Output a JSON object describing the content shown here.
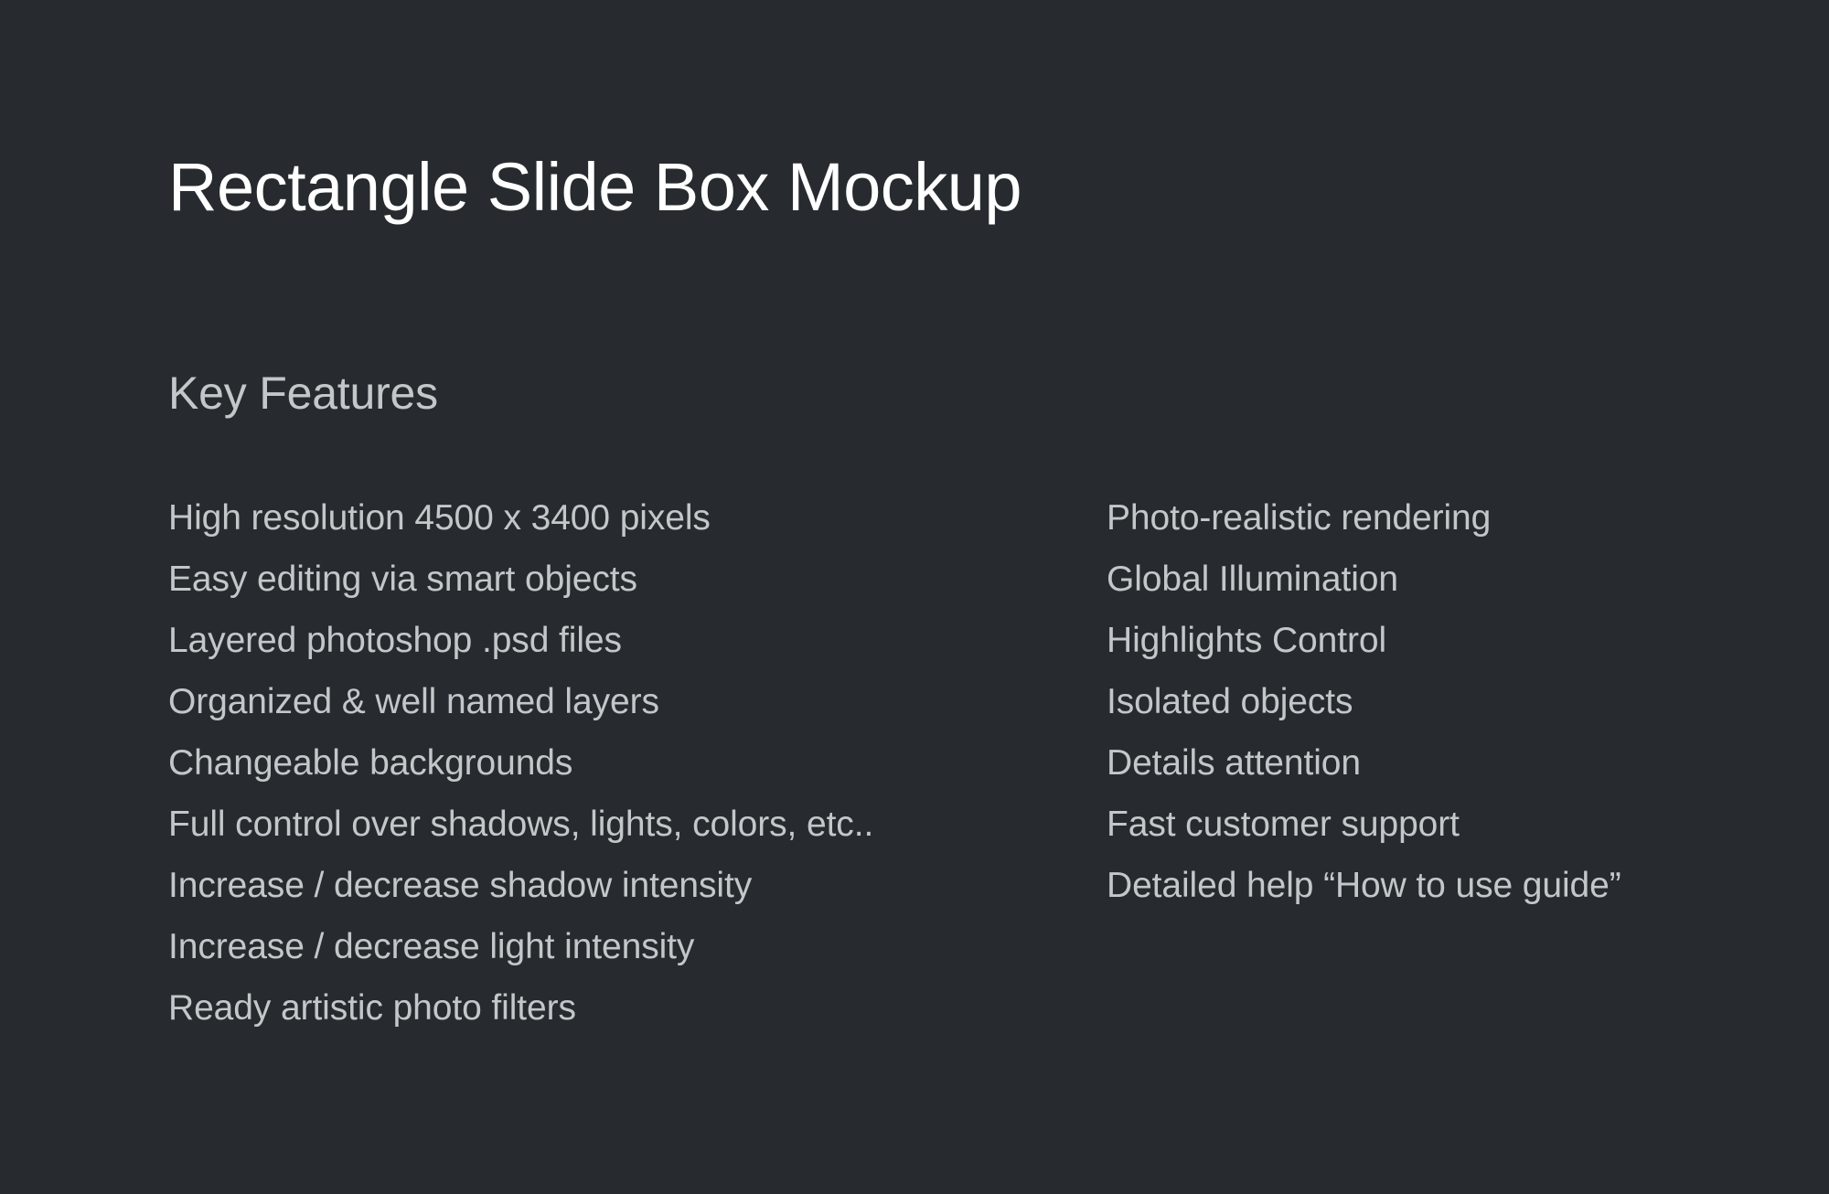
{
  "theme": {
    "background": "#272b2f",
    "title_color": "#ffffff",
    "text_color": "#c3c7c9"
  },
  "header": {
    "title": "Rectangle Slide Box Mockup"
  },
  "features_section": {
    "heading": "Key Features",
    "left_column": [
      "High resolution 4500 x 3400 pixels",
      "Easy editing via smart objects",
      "Layered photoshop .psd files",
      "Organized & well named layers",
      "Changeable backgrounds",
      "Full control over shadows, lights, colors, etc..",
      "Increase / decrease shadow intensity",
      "Increase / decrease light intensity",
      "Ready artistic photo filters"
    ],
    "right_column": [
      "Photo-realistic rendering",
      "Global Illumination",
      "Highlights Control",
      "Isolated objects",
      "Details attention",
      "Fast customer support",
      "Detailed help “How to use guide”"
    ]
  }
}
